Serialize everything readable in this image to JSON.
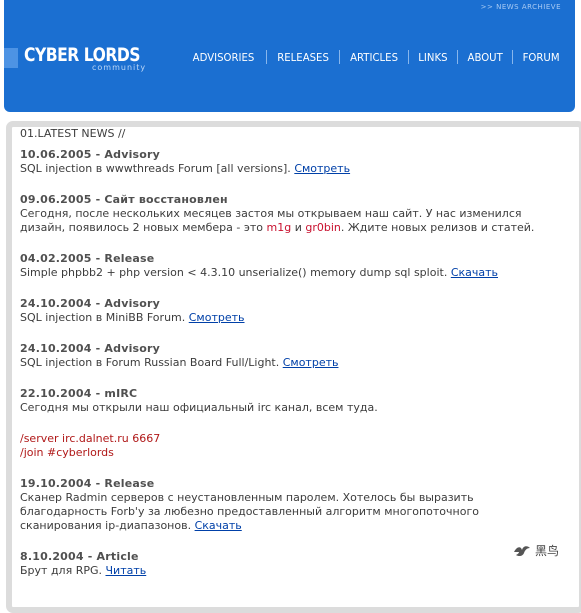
{
  "header": {
    "archive_link": ">> NEWS ARCHIEVE",
    "logo_title": "CYBER LORDS",
    "logo_subtitle": "community",
    "nav": [
      "ADVISORIES",
      "RELEASES",
      "ARTICLES",
      "LINKS",
      "ABOUT",
      "FORUM"
    ]
  },
  "news": {
    "title": "01.LATEST NEWS //",
    "entries": [
      {
        "head": "10.06.2005 - Advisory",
        "text": "SQL injection в wwwthreads Forum [all versions]. ",
        "link": "Смотреть"
      },
      {
        "head": "09.06.2005 - Сайт восстановлен",
        "text_a": "Сегодня, после нескольких месяцев застоя мы открываем наш сайт. У нас изменился дизайн, появилось 2 новых мембера - это ",
        "member1": "m1g",
        "text_b": " и ",
        "member2": "gr0bin",
        "text_c": ". Ждите новых релизов и статей."
      },
      {
        "head": "04.02.2005 - Release",
        "text": "Simple phpbb2 + php version < 4.3.10 unserialize() memory dump sql sploit. ",
        "link": "Скачать"
      },
      {
        "head": "24.10.2004 - Advisory",
        "text": "SQL injection в MiniBB Forum. ",
        "link": "Смотреть"
      },
      {
        "head": "24.10.2004 - Advisory",
        "text": "SQL injection в Forum Russian Board Full/Light. ",
        "link": "Смотреть"
      },
      {
        "head": "22.10.2004 - mIRC",
        "text": "Сегодня мы открыли наш официальный irc канал, всем туда.",
        "irc_server": "/server irc.dalnet.ru 6667",
        "irc_join": "/join #cyberlords"
      },
      {
        "head": "19.10.2004 - Release",
        "text": "Сканер Radmin серверов с неустановленным паролем. Хотелось бы выразить благодарность Forb'y за любезно предоставленный алгоритм многопоточного сканирования ip-диапазонов. ",
        "link": "Скачать"
      },
      {
        "head": "8.10.2004 - Article",
        "text": "Брут для RPG. ",
        "link": "Читать"
      }
    ]
  },
  "watermark": {
    "text": "黑鸟"
  },
  "colors": {
    "header_blue": "#1b6fd1",
    "highlight_red": "#c8102e",
    "link_blue": "#0040a8",
    "panel_border": "#dcdcdc"
  }
}
